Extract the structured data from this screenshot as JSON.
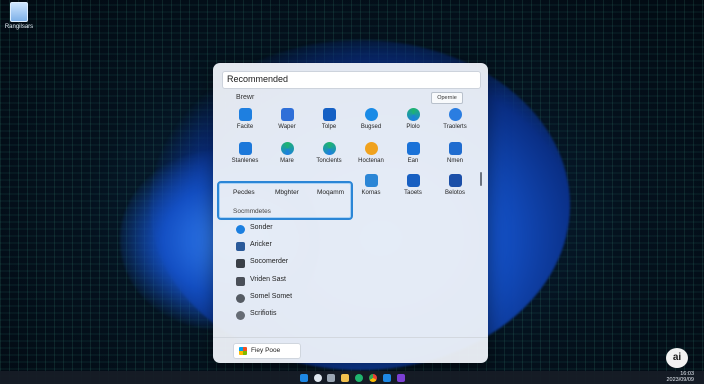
{
  "desktop": {
    "recycle_label": "Rangilsars"
  },
  "start_menu": {
    "header": "Recommended",
    "section_label": "Brewr",
    "options_label": "Opernie",
    "apps_row1": [
      "Facite",
      "Waper",
      "Tolpe",
      "Bugsed",
      "Plolo",
      "Traolerts"
    ],
    "apps_row2": [
      "Stanlenes",
      "Mare",
      "Tonclents",
      "Hoctenan",
      "Ean",
      "Nmen"
    ],
    "apps_row3_right": [
      "Kornas",
      "Taoets",
      "Belotos"
    ],
    "selection": {
      "items": [
        "Pecdes",
        "Mbghter",
        "Moqamm"
      ],
      "partial": "Socmmdetes"
    },
    "list": [
      "Sonder",
      "Aricker",
      "Socomerder",
      "Vriden Sast",
      "Somel Somet",
      "Scrifiotis"
    ],
    "power_label": "Fiey Pooe"
  },
  "taskbar": {
    "time": "16:03",
    "date": "2023/09/09"
  },
  "watermark": "ai",
  "colors": {
    "accent": "#2b86d6",
    "panel": "#ecf0f7"
  }
}
